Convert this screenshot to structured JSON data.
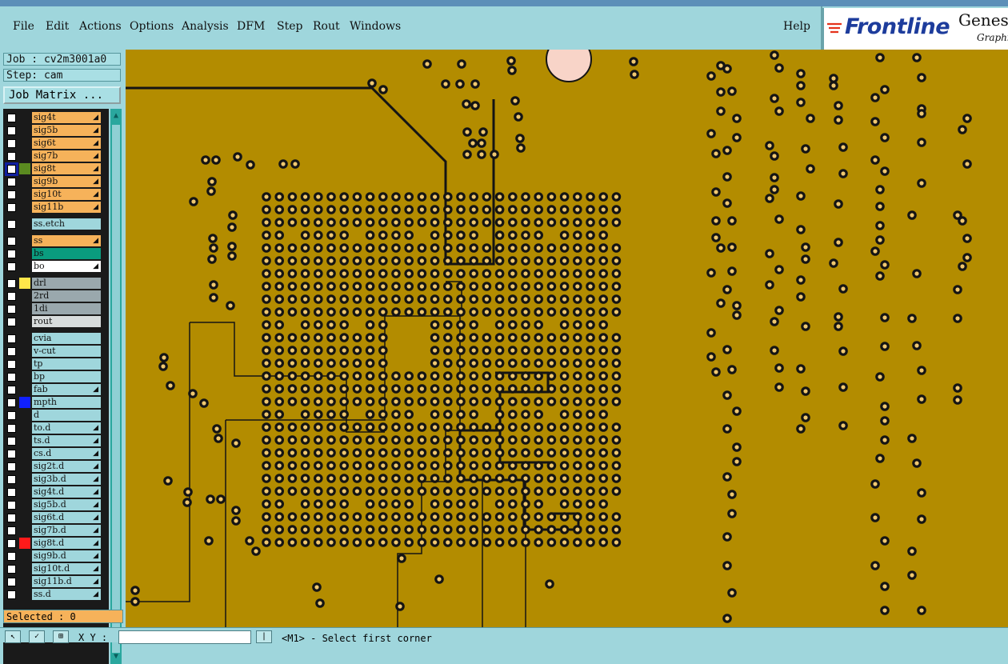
{
  "menubar": {
    "items": [
      "File",
      "Edit",
      "Actions",
      "Options",
      "Analysis",
      "DFM",
      "Step",
      "Rout",
      "Windows"
    ],
    "help": "Help"
  },
  "logo": {
    "brand": "Frontline",
    "product": "Genes",
    "subtitle": "Graphi"
  },
  "job": {
    "label": "Job : cv2m3001a0",
    "step": "Step: cam",
    "matrix_button": "Job Matrix ..."
  },
  "layers": [
    {
      "name": "sig4t",
      "kind": "signal"
    },
    {
      "name": "sig5b",
      "kind": "signal"
    },
    {
      "name": "sig6t",
      "kind": "signal"
    },
    {
      "name": "sig7b",
      "kind": "signal"
    },
    {
      "name": "sig8t",
      "kind": "signal",
      "active": true
    },
    {
      "name": "sig9b",
      "kind": "signal"
    },
    {
      "name": "sig10t",
      "kind": "signal"
    },
    {
      "name": "sig11b",
      "kind": "signal"
    },
    {
      "name": "ss.etch",
      "kind": "plain"
    },
    {
      "name": "ss",
      "kind": "signal"
    },
    {
      "name": "bs",
      "kind": "green"
    },
    {
      "name": "bo",
      "kind": "white"
    },
    {
      "name": "drl",
      "kind": "gray",
      "color": "#ffe64a"
    },
    {
      "name": "2rd",
      "kind": "gray"
    },
    {
      "name": "1di",
      "kind": "gray"
    },
    {
      "name": "rout",
      "kind": "light"
    },
    {
      "name": "cvia",
      "kind": "plain"
    },
    {
      "name": "v-cut",
      "kind": "plain"
    },
    {
      "name": "tp",
      "kind": "plain"
    },
    {
      "name": "bp",
      "kind": "plain"
    },
    {
      "name": "fab",
      "kind": "plain"
    },
    {
      "name": "mpth",
      "kind": "plain",
      "color": "#1020ff"
    },
    {
      "name": "d",
      "kind": "plain"
    },
    {
      "name": "to.d",
      "kind": "plain"
    },
    {
      "name": "ts.d",
      "kind": "plain"
    },
    {
      "name": "cs.d",
      "kind": "plain"
    },
    {
      "name": "sig2t.d",
      "kind": "plain"
    },
    {
      "name": "sig3b.d",
      "kind": "plain"
    },
    {
      "name": "sig4t.d",
      "kind": "plain"
    },
    {
      "name": "sig5b.d",
      "kind": "plain"
    },
    {
      "name": "sig6t.d",
      "kind": "plain"
    },
    {
      "name": "sig7b.d",
      "kind": "plain"
    },
    {
      "name": "sig8t.d",
      "kind": "plain",
      "color": "#ff1a1a"
    },
    {
      "name": "sig9b.d",
      "kind": "plain"
    },
    {
      "name": "sig10t.d",
      "kind": "plain"
    },
    {
      "name": "sig11b.d",
      "kind": "plain"
    },
    {
      "name": "ss.d",
      "kind": "plain"
    }
  ],
  "selected": "Selected : 0",
  "status": {
    "xy_label": "X Y :",
    "prompt": "<M1> - Select first corner"
  },
  "colors": {
    "board": "#b38c00",
    "pad": "#141414",
    "accent": "#f6b25a"
  }
}
